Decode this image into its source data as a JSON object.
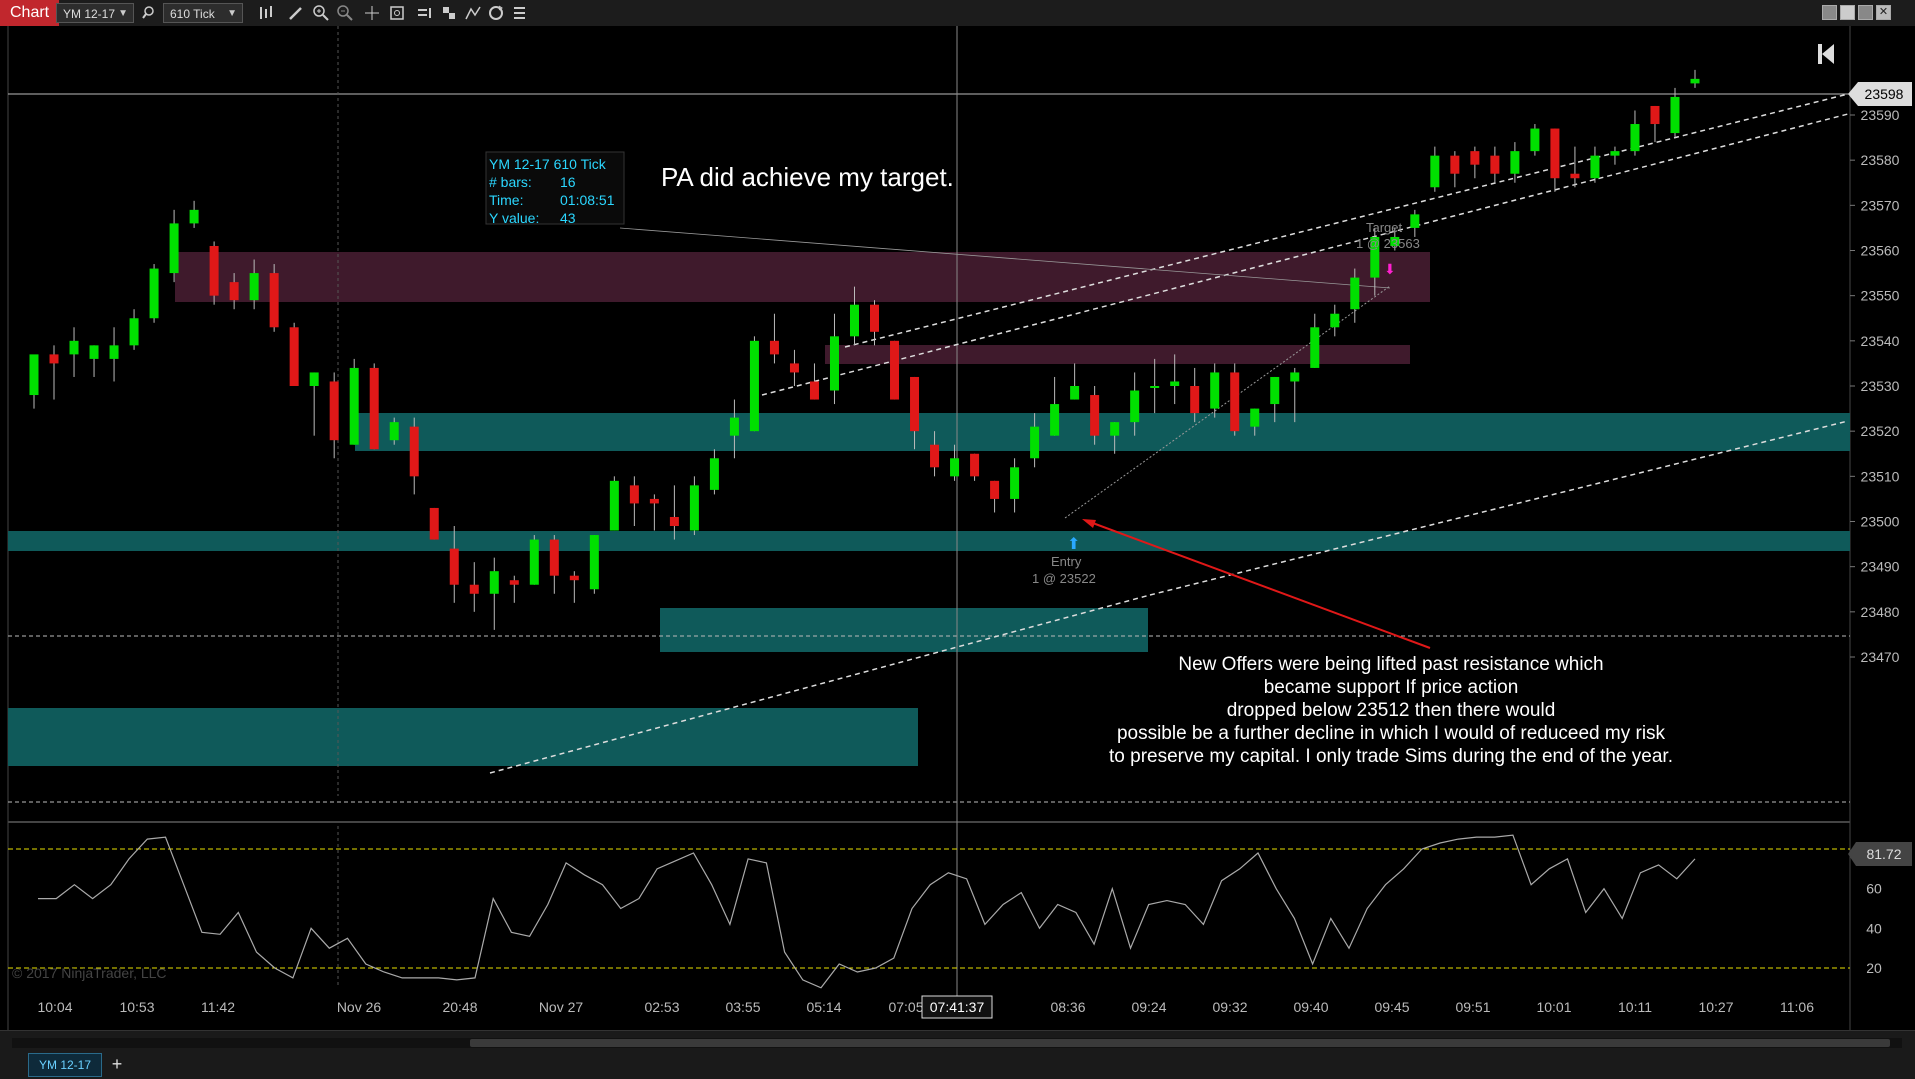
{
  "toolbar": {
    "tab_label": "Chart",
    "instrument": "YM 12-17",
    "interval": "610 Tick",
    "icons": [
      "search-icon",
      "bar-type-icon",
      "pencil-icon",
      "zoom-in-icon",
      "zoom-out-icon",
      "crosshair-icon",
      "data-box-icon",
      "strategies-icon",
      "indicators-icon",
      "drawing-tools-icon",
      "refresh-icon",
      "properties-icon"
    ],
    "window_icons": [
      "restore-icon",
      "maximize-icon",
      "tile-icon",
      "close-icon"
    ]
  },
  "chart": {
    "annotation_title": "PA did achieve my target.",
    "databox": {
      "header": "YM 12-17 610 Tick",
      "rows": [
        {
          "label": "# bars:",
          "value": "16"
        },
        {
          "label": "Time:",
          "value": "01:08:51"
        },
        {
          "label": "Y value:",
          "value": "43"
        }
      ]
    },
    "note_lines": [
      "New Offers were being lifted past resistance which",
      "became support  If price action",
      "dropped below 23512 then there would",
      "possible be a further decline in which I would of reduceed my risk",
      "to preserve my capital. I only trade Sims during the end of the year."
    ],
    "target_label": "Target",
    "target_price": "1 @ 23563",
    "entry_label": "Entry",
    "entry_price": "1 @ 23522",
    "last_price": "23598",
    "oscillator_value": "81.72",
    "price_ticks": [
      "23590",
      "23580",
      "23570",
      "23560",
      "23550",
      "23540",
      "23530",
      "23520",
      "23510",
      "23500",
      "23490",
      "23480",
      "23470"
    ],
    "osc_ticks": [
      "60",
      "40",
      "20"
    ],
    "time_ticks": [
      "10:04",
      "10:53",
      "11:42",
      "Nov 26",
      "20:48",
      "Nov 27",
      "02:53",
      "03:55",
      "05:14",
      "07:05",
      "08:36",
      "09:24",
      "09:32",
      "09:40",
      "09:45",
      "09:51",
      "10:01",
      "10:11",
      "10:27",
      "11:06"
    ],
    "crosshair_time": "07:41:37",
    "watermark": "© 2017 NinjaTrader, LLC",
    "colors": {
      "up": "#00e000",
      "down": "#e01818",
      "zone_teal": "#0f5a5a",
      "zone_maroon": "#4a1e34",
      "background": "#000000"
    }
  },
  "bottom": {
    "series_tab": "YM 12-17",
    "add_tab": "+"
  },
  "chart_data": {
    "type": "candlestick",
    "y_range": [
      23468,
      23602
    ],
    "candles": [
      [
        23528,
        23537,
        23525,
        23536
      ],
      [
        23537,
        23535,
        23527,
        23539
      ],
      [
        23537,
        23540,
        23532,
        23543
      ],
      [
        23536,
        23539,
        23532,
        23539
      ],
      [
        23536,
        23539,
        23531,
        23543
      ],
      [
        23539,
        23545,
        23538,
        23547
      ],
      [
        23545,
        23556,
        23544,
        23557
      ],
      [
        23555,
        23566,
        23553,
        23569
      ],
      [
        23566,
        23569,
        23565,
        23571
      ],
      [
        23561,
        23550,
        23548,
        23562
      ],
      [
        23553,
        23549,
        23547,
        23555
      ],
      [
        23549,
        23555,
        23547,
        23558
      ],
      [
        23555,
        23543,
        23542,
        23557
      ],
      [
        23543,
        23530,
        23530,
        23544
      ],
      [
        23530,
        23533,
        23519,
        23533
      ],
      [
        23531,
        23518,
        23514,
        23533
      ],
      [
        23517,
        23534,
        23517,
        23536
      ],
      [
        23534,
        23516,
        23516,
        23535
      ],
      [
        23518,
        23522,
        23517,
        23523
      ],
      [
        23521,
        23510,
        23506,
        23523
      ],
      [
        23503,
        23496,
        23496,
        23503
      ],
      [
        23494,
        23486,
        23482,
        23499
      ],
      [
        23486,
        23484,
        23480,
        23491
      ],
      [
        23484,
        23489,
        23476,
        23492
      ],
      [
        23487,
        23486,
        23482,
        23488
      ],
      [
        23486,
        23496,
        23486,
        23497
      ],
      [
        23496,
        23488,
        23484,
        23497
      ],
      [
        23488,
        23487,
        23482,
        23489
      ],
      [
        23485,
        23497,
        23484,
        23497
      ],
      [
        23498,
        23509,
        23498,
        23510
      ],
      [
        23508,
        23504,
        23499,
        23510
      ],
      [
        23505,
        23504,
        23498,
        23506
      ],
      [
        23501,
        23499,
        23496,
        23508
      ],
      [
        23498,
        23508,
        23497,
        23510
      ],
      [
        23507,
        23514,
        23506,
        23516
      ],
      [
        23519,
        23523,
        23514,
        23527
      ],
      [
        23520,
        23540,
        23520,
        23541
      ],
      [
        23540,
        23537,
        23535,
        23546
      ],
      [
        23535,
        23533,
        23530,
        23538
      ],
      [
        23531,
        23527,
        23527,
        23535
      ],
      [
        23529,
        23541,
        23526,
        23546
      ],
      [
        23541,
        23548,
        23539,
        23552
      ],
      [
        23548,
        23542,
        23539,
        23549
      ],
      [
        23540,
        23527,
        23527,
        23540
      ],
      [
        23532,
        23520,
        23516,
        23532
      ],
      [
        23517,
        23512,
        23510,
        23520
      ],
      [
        23510,
        23514,
        23509,
        23517
      ],
      [
        23515,
        23510,
        23509,
        23515
      ],
      [
        23509,
        23505,
        23502,
        23509
      ],
      [
        23505,
        23512,
        23502,
        23514
      ],
      [
        23514,
        23521,
        23512,
        23524
      ],
      [
        23519,
        23526,
        23519,
        23532
      ],
      [
        23527,
        23530,
        23527,
        23535
      ],
      [
        23528,
        23519,
        23517,
        23530
      ],
      [
        23519,
        23522,
        23515,
        23522
      ],
      [
        23522,
        23529,
        23519,
        23533
      ],
      [
        23530,
        23530,
        23524,
        23536
      ],
      [
        23530,
        23531,
        23526,
        23537
      ],
      [
        23530,
        23524,
        23522,
        23534
      ],
      [
        23525,
        23533,
        23523,
        23535
      ],
      [
        23533,
        23520,
        23519,
        23535
      ],
      [
        23521,
        23525,
        23519,
        23525
      ],
      [
        23526,
        23532,
        23522,
        23532
      ],
      [
        23531,
        23533,
        23522,
        23534
      ],
      [
        23534,
        23543,
        23534,
        23546
      ],
      [
        23543,
        23546,
        23541,
        23548
      ],
      [
        23547,
        23554,
        23544,
        23556
      ],
      [
        23554,
        23563,
        23550,
        23565
      ],
      [
        23561,
        23563,
        23560,
        23565
      ],
      [
        23565,
        23568,
        23563,
        23569
      ],
      [
        23574,
        23581,
        23573,
        23583
      ],
      [
        23581,
        23577,
        23574,
        23582
      ],
      [
        23582,
        23579,
        23576,
        23583
      ],
      [
        23581,
        23577,
        23575,
        23583
      ],
      [
        23577,
        23582,
        23575,
        23584
      ],
      [
        23582,
        23587,
        23581,
        23588
      ],
      [
        23587,
        23576,
        23573,
        23587
      ],
      [
        23577,
        23576,
        23574,
        23583
      ],
      [
        23576,
        23581,
        23575,
        23583
      ],
      [
        23581,
        23582,
        23579,
        23583
      ],
      [
        23582,
        23588,
        23581,
        23591
      ],
      [
        23592,
        23588,
        23584,
        23592
      ],
      [
        23586,
        23594,
        23585,
        23596
      ],
      [
        23597,
        23598,
        23596,
        23600
      ]
    ],
    "oscillator": [
      55,
      55,
      62,
      55,
      62,
      75,
      85,
      86,
      62,
      38,
      37,
      48,
      28,
      20,
      15,
      40,
      30,
      35,
      22,
      18,
      15,
      15,
      15,
      14,
      15,
      55,
      38,
      36,
      52,
      73,
      67,
      62,
      50,
      55,
      70,
      74,
      78,
      62,
      42,
      75,
      73,
      28,
      14,
      10,
      22,
      18,
      20,
      25,
      50,
      62,
      68,
      65,
      42,
      52,
      58,
      40,
      52,
      48,
      32,
      60,
      30,
      52,
      54,
      52,
      42,
      64,
      70,
      78,
      60,
      45,
      22,
      45,
      30,
      50,
      62,
      70,
      80,
      83,
      85,
      86,
      86,
      87,
      62,
      70,
      75,
      48,
      60,
      45,
      68,
      72,
      65,
      75
    ]
  }
}
